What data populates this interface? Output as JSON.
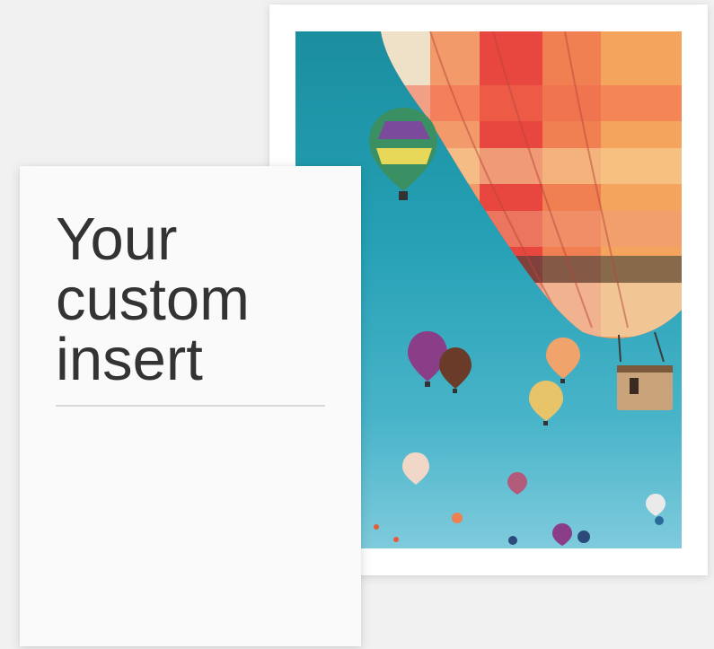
{
  "insert": {
    "title": "Your\ncustom\ninsert"
  },
  "photo": {
    "sky_top_color": "#1b8ea0",
    "sky_bottom_color": "#7ecbdc"
  }
}
